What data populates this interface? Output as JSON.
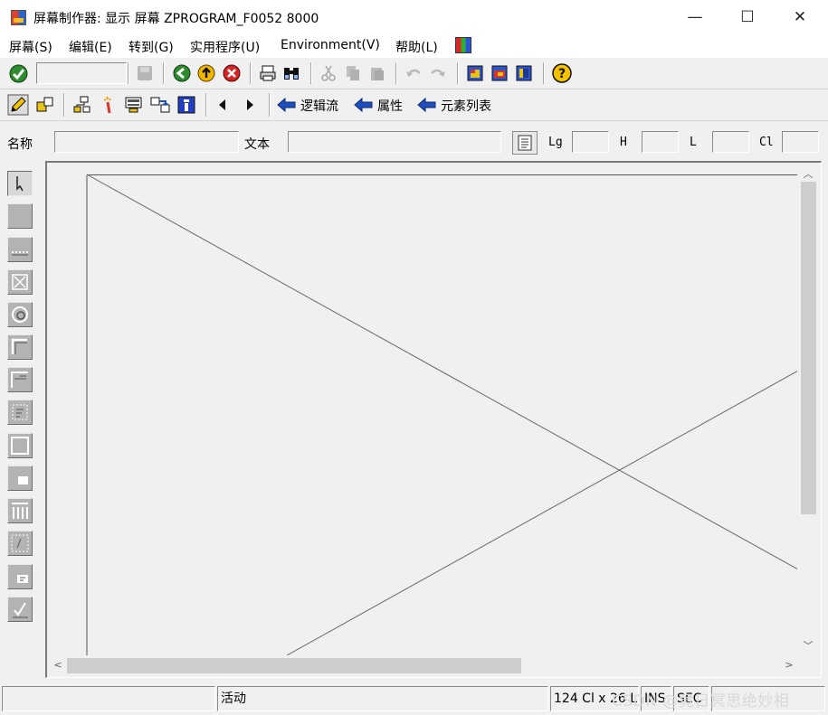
{
  "window": {
    "title": "屏幕制作器:  显示 屏幕 ZPROGRAM_F0052 8000",
    "minimize_glyph": "—",
    "maximize_glyph": "☐",
    "close_glyph": "✕"
  },
  "menu": {
    "items": [
      {
        "label": "屏幕(S)"
      },
      {
        "label": "编辑(E)"
      },
      {
        "label": "转到(G)"
      },
      {
        "label": "实用程序(U)"
      },
      {
        "label": "Environment(V)"
      },
      {
        "label": "帮助(L)"
      }
    ]
  },
  "application_toolbar": {
    "nav_buttons": [
      {
        "label": "逻辑流"
      },
      {
        "label": "属性"
      },
      {
        "label": "元素列表"
      }
    ]
  },
  "fields": {
    "name_label": "名称",
    "name_value": "",
    "text_label": "文本",
    "text_value": "",
    "lg_label": "Lg",
    "lg_value": "",
    "h_label": "H",
    "h_value": "",
    "l_label": "L",
    "l_value": "",
    "cl_label": "Cl",
    "cl_value": ""
  },
  "status_bar": {
    "status_text": "活动",
    "dimensions": "124 Cl x 26 L",
    "mode": "INS",
    "sec": "SEC"
  },
  "watermark": "CSDN @竟日冥思绝妙相",
  "colors": {
    "window_bg": "#f0f0f0",
    "title_bg": "#ffffff",
    "palette_button": "#b3b3b3",
    "accent_blue": "#1f4fbf"
  }
}
